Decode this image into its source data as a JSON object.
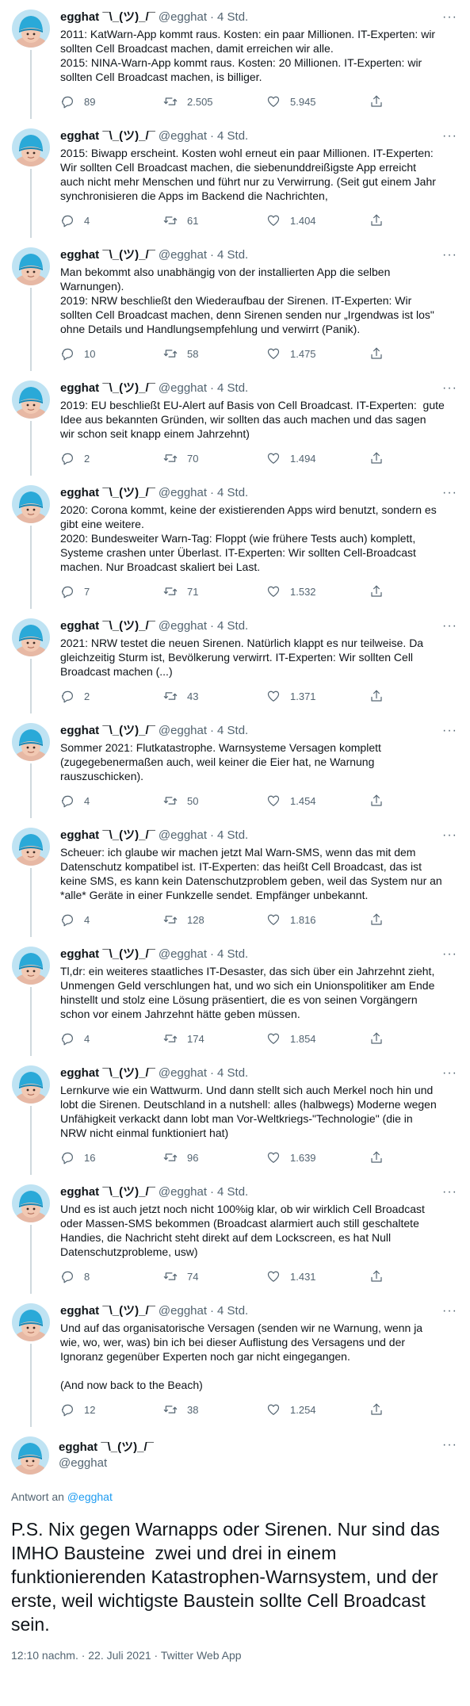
{
  "author": {
    "name": "egghat ¯\\_(ツ)_/¯",
    "handle": "@egghat",
    "dot": "·",
    "time": "4 Std."
  },
  "tweets": [
    {
      "text": "2011: KatWarn-App kommt raus. Kosten: ein paar Millionen. IT-Experten: wir\nsollten Cell Broadcast machen, damit erreichen wir alle.\n2015: NINA-Warn-App kommt raus. Kosten: 20 Millionen. IT-Experten: wir\nsollten Cell Broadcast machen, is billiger.",
      "replies": "89",
      "retweets": "2.505",
      "likes": "5.945"
    },
    {
      "text": "2015: Biwapp erscheint. Kosten wohl erneut ein paar Millionen. IT-Experten:\nWir sollten Cell Broadcast machen, die siebenunddreißigste App erreicht\nauch nicht mehr Menschen und führt nur zu Verwirrung. (Seit gut einem Jahr\nsynchronisieren die Apps im Backend die Nachrichten,",
      "replies": "4",
      "retweets": "61",
      "likes": "1.404"
    },
    {
      "text": "Man bekommt also unabhängig von der installierten App die selben\nWarnungen).\n2019: NRW beschließt den Wiederaufbau der Sirenen. IT-Experten: Wir\nsollten Cell Broadcast machen, denn Sirenen senden nur „Irgendwas ist los\"\nohne Details und Handlungsempfehlung und verwirrt (Panik).",
      "replies": "10",
      "retweets": "58",
      "likes": "1.475"
    },
    {
      "text": "2019: EU beschließt EU-Alert auf Basis von Cell Broadcast. IT-Experten:  gute\nIdee aus bekannten Gründen, wir sollten das auch machen und das sagen\nwir schon seit knapp einem Jahrzehnt)",
      "replies": "2",
      "retweets": "70",
      "likes": "1.494"
    },
    {
      "text": "2020: Corona kommt, keine der existierenden Apps wird benutzt, sondern es\ngibt eine weitere.\n2020: Bundesweiter Warn-Tag: Floppt (wie frühere Tests auch) komplett,\nSysteme crashen unter Überlast. IT-Experten: Wir sollten Cell-Broadcast\nmachen. Nur Broadcast skaliert bei Last.",
      "replies": "7",
      "retweets": "71",
      "likes": "1.532"
    },
    {
      "text": "2021: NRW testet die neuen Sirenen. Natürlich klappt es nur teilweise. Da\ngleichzeitig Sturm ist, Bevölkerung verwirrt. IT-Experten: Wir sollten Cell\nBroadcast machen (...)",
      "replies": "2",
      "retweets": "43",
      "likes": "1.371"
    },
    {
      "text": "Sommer 2021: Flutkatastrophe. Warnsysteme Versagen komplett\n(zugegebenermaßen auch, weil keiner die Eier hat, ne Warnung\nrauszuschicken).",
      "replies": "4",
      "retweets": "50",
      "likes": "1.454"
    },
    {
      "text": "Scheuer: ich glaube wir machen jetzt Mal Warn-SMS, wenn das mit dem\nDatenschutz kompatibel ist. IT-Experten: das heißt Cell Broadcast, das ist\nkeine SMS, es kann kein Datenschutzproblem geben, weil das System nur an\n*alle* Geräte in einer Funkzelle sendet. Empfänger unbekannt.",
      "replies": "4",
      "retweets": "128",
      "likes": "1.816"
    },
    {
      "text": "Tl,dr: ein weiteres staatliches IT-Desaster, das sich über ein Jahrzehnt zieht,\nUnmengen Geld verschlungen hat, und wo sich ein Unionspolitiker am Ende\nhinstellt und stolz eine Lösung präsentiert, die es von seinen Vorgängern\nschon vor einem Jahrzehnt hätte geben müssen.",
      "replies": "4",
      "retweets": "174",
      "likes": "1.854"
    },
    {
      "text": "Lernkurve wie ein Wattwurm. Und dann stellt sich auch Merkel noch hin und\nlobt die Sirenen. Deutschland in a nutshell: alles (halbwegs) Moderne wegen\nUnfähigkeit verkackt dann lobt man Vor-Weltkriegs-\"Technologie\" (die in\nNRW nicht einmal funktioniert hat)",
      "replies": "16",
      "retweets": "96",
      "likes": "1.639"
    },
    {
      "text": "Und es ist auch jetzt noch nicht 100%ig klar, ob wir wirklich Cell Broadcast\noder Massen-SMS bekommen (Broadcast alarmiert auch still geschaltete\nHandies, die Nachricht steht direkt auf dem Lockscreen, es hat Null\nDatenschutzprobleme, usw)",
      "replies": "8",
      "retweets": "74",
      "likes": "1.431"
    },
    {
      "text": "Und auf das organisatorische Versagen (senden wir ne Warnung, wenn ja\nwie, wo, wer, was) bin ich bei dieser Auflistung des Versagens und der\nIgnoranz gegenüber Experten noch gar nicht eingegangen.\n\n(And now back to the Beach)",
      "replies": "12",
      "retweets": "38",
      "likes": "1.254"
    }
  ],
  "final": {
    "reply_prefix": "Antwort an",
    "reply_handle": "@egghat",
    "text": "P.S. Nix gegen Warnapps oder Sirenen. Nur sind das\nIMHO Bausteine  zwei und drei in einem\nfunktionierenden Katastrophen-Warnsystem, und der\nerste, weil wichtigste Baustein sollte Cell Broadcast sein.",
    "meta": "12:10 nachm. · 22. Juli 2021 · Twitter Web App"
  },
  "icons": {
    "reply": "reply-icon",
    "retweet": "retweet-icon",
    "like": "heart-icon",
    "share": "share-icon",
    "more": "more-icon"
  },
  "colors": {
    "accent": "#1d9bf0",
    "muted": "#536471",
    "line": "#cfd9de",
    "avatar_bg": "#bfe3f3",
    "helmet": "#2aa9d8"
  }
}
